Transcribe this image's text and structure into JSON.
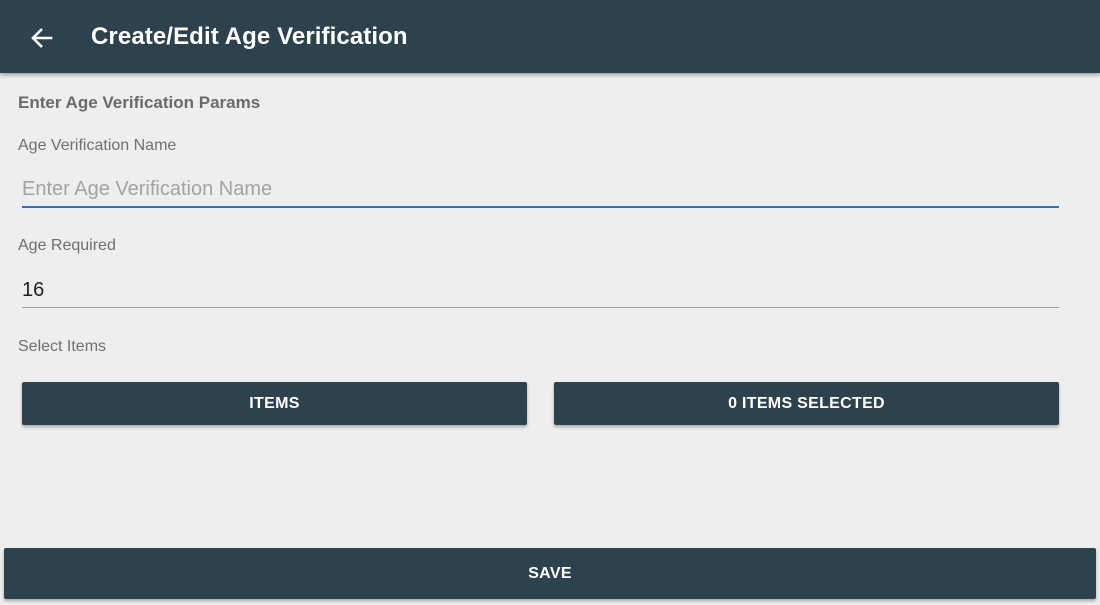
{
  "appbar": {
    "title": "Create/Edit Age Verification",
    "back_icon": "arrow-left-icon",
    "background": "#2e424e"
  },
  "form": {
    "section_title": "Enter Age Verification Params",
    "name_field": {
      "label": "Age Verification Name",
      "placeholder": "Enter Age Verification Name",
      "value": ""
    },
    "age_field": {
      "label": "Age Required",
      "value": "16"
    },
    "items": {
      "label": "Select Items",
      "items_button_label": "ITEMS",
      "selected_button_label": "0 ITEMS SELECTED"
    }
  },
  "footer": {
    "save_label": "SAVE"
  },
  "colors": {
    "accent": "#2f6fc0",
    "button": "#2e424e",
    "background": "#eeeeee"
  }
}
